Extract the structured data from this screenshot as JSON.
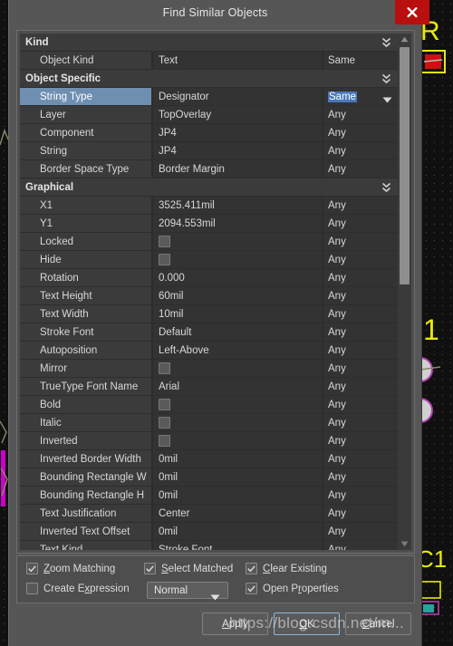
{
  "window": {
    "title": "Find Similar Objects",
    "close_icon": "close-icon",
    "accent_close": "#b90f0f",
    "accent_selection": "#6f8fb0"
  },
  "property_list": {
    "groups": [
      {
        "label": "Kind",
        "expand_icon": "double-chevron-down-icon",
        "rows": [
          {
            "name": "Object Kind",
            "value": "Text",
            "match": "Same",
            "type": "text"
          }
        ]
      },
      {
        "label": "Object Specific",
        "expand_icon": "double-chevron-down-icon",
        "rows": [
          {
            "name": "String Type",
            "value": "Designator",
            "match": "Same",
            "type": "text",
            "selected": true,
            "match_highlight": true,
            "dropdown": true
          },
          {
            "name": "Layer",
            "value": "TopOverlay",
            "match": "Any",
            "type": "text"
          },
          {
            "name": "Component",
            "value": "JP4",
            "match": "Any",
            "type": "text"
          },
          {
            "name": "String",
            "value": "JP4",
            "match": "Any",
            "type": "text"
          },
          {
            "name": "Border Space Type",
            "value": "Border Margin",
            "match": "Any",
            "type": "text"
          }
        ]
      },
      {
        "label": "Graphical",
        "expand_icon": "double-chevron-down-icon",
        "rows": [
          {
            "name": "X1",
            "value": "3525.411mil",
            "match": "Any",
            "type": "text"
          },
          {
            "name": "Y1",
            "value": "2094.553mil",
            "match": "Any",
            "type": "text"
          },
          {
            "name": "Locked",
            "value": "",
            "match": "Any",
            "type": "checkbox",
            "checked": false
          },
          {
            "name": "Hide",
            "value": "",
            "match": "Any",
            "type": "checkbox",
            "checked": false
          },
          {
            "name": "Rotation",
            "value": "0.000",
            "match": "Any",
            "type": "text"
          },
          {
            "name": "Text Height",
            "value": "60mil",
            "match": "Any",
            "type": "text"
          },
          {
            "name": "Text Width",
            "value": "10mil",
            "match": "Any",
            "type": "text"
          },
          {
            "name": "Stroke Font",
            "value": "Default",
            "match": "Any",
            "type": "text"
          },
          {
            "name": "Autoposition",
            "value": "Left-Above",
            "match": "Any",
            "type": "text"
          },
          {
            "name": "Mirror",
            "value": "",
            "match": "Any",
            "type": "checkbox",
            "checked": false
          },
          {
            "name": "TrueType Font Name",
            "value": "Arial",
            "match": "Any",
            "type": "text"
          },
          {
            "name": "Bold",
            "value": "",
            "match": "Any",
            "type": "checkbox",
            "checked": false
          },
          {
            "name": "Italic",
            "value": "",
            "match": "Any",
            "type": "checkbox",
            "checked": false
          },
          {
            "name": "Inverted",
            "value": "",
            "match": "Any",
            "type": "checkbox",
            "checked": false
          },
          {
            "name": "Inverted Border Width",
            "value": "0mil",
            "match": "Any",
            "type": "text"
          },
          {
            "name": "Bounding Rectangle W",
            "value": "0mil",
            "match": "Any",
            "type": "text"
          },
          {
            "name": "Bounding Rectangle H",
            "value": "0mil",
            "match": "Any",
            "type": "text"
          },
          {
            "name": "Text Justification",
            "value": "Center",
            "match": "Any",
            "type": "text"
          },
          {
            "name": "Inverted Text Offset",
            "value": "0mil",
            "match": "Any",
            "type": "text"
          },
          {
            "name": "Text Kind",
            "value": "Stroke Font",
            "match": "Any",
            "type": "text"
          }
        ]
      }
    ],
    "scrollbar": {
      "up_icon": "scroll-up-arrow-icon",
      "down_icon": "scroll-down-arrow-icon",
      "thumb": "scrollbar-thumb"
    }
  },
  "options": {
    "checkboxes": [
      {
        "label_pre": "",
        "accel": "Z",
        "label_post": "oom Matching",
        "checked": true,
        "name": "zoom-matching"
      },
      {
        "label_pre": "",
        "accel": "S",
        "label_post": "elect Matched",
        "checked": true,
        "name": "select-matched"
      },
      {
        "label_pre": "",
        "accel": "C",
        "label_post": "lear Existing",
        "checked": true,
        "name": "clear-existing"
      },
      {
        "label_pre": "Create E",
        "accel": "x",
        "label_post": "pression",
        "checked": false,
        "name": "create-expression"
      },
      {
        "label_pre": "Open P",
        "accel": "r",
        "label_post": "operties",
        "checked": true,
        "name": "open-properties"
      }
    ],
    "mode_select": {
      "value": "Normal",
      "caret_icon": "chevron-down-icon"
    }
  },
  "footer": {
    "buttons": [
      {
        "pre": "",
        "accel": "A",
        "post": "pply",
        "name": "apply-button",
        "default": false
      },
      {
        "pre": "",
        "accel": "O",
        "post": "K",
        "name": "ok-button",
        "default": true
      },
      {
        "pre": "",
        "accel": "C",
        "post": "ancel",
        "name": "cancel-button",
        "default": false
      }
    ]
  },
  "watermark": {
    "text": "https://blog.csdn.net/m..."
  }
}
